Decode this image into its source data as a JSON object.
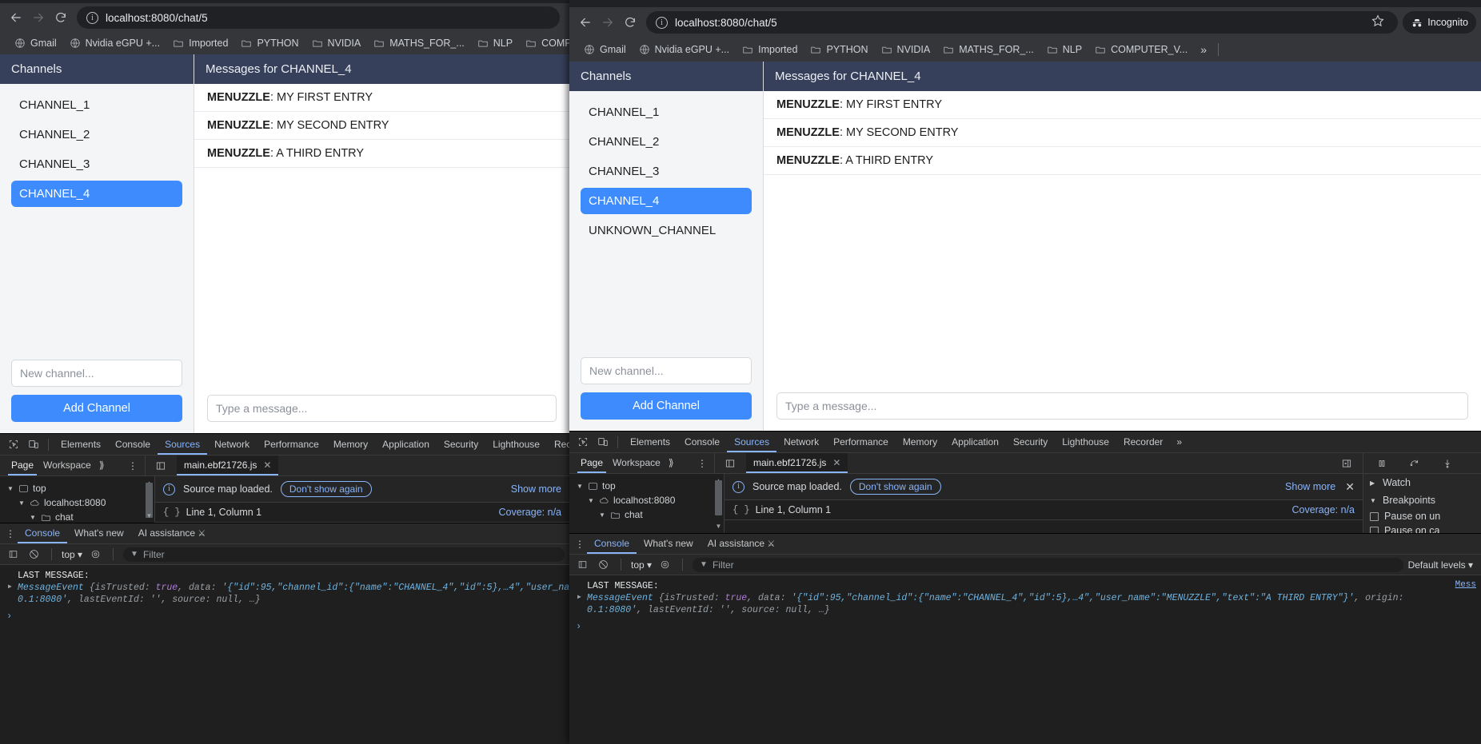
{
  "browser": {
    "url": "localhost:8080/chat/5",
    "nav": {
      "back": "back-arrow",
      "forward": "forward-arrow",
      "reload": "reload"
    },
    "bookmarks": [
      {
        "label": "Gmail",
        "icon": "globe"
      },
      {
        "label": "Nvidia eGPU +...",
        "icon": "globe"
      },
      {
        "label": "Imported",
        "icon": "folder"
      },
      {
        "label": "PYTHON",
        "icon": "folder"
      },
      {
        "label": "NVIDIA",
        "icon": "folder"
      },
      {
        "label": "MATHS_FOR_...",
        "icon": "folder"
      },
      {
        "label": "NLP",
        "icon": "folder"
      },
      {
        "label": "COMPUTER_V...",
        "icon": "folder"
      }
    ],
    "bookmarks_overflow": "»",
    "incognito_label": "Incognito"
  },
  "chat": {
    "sidebar_title": "Channels",
    "channels_left": [
      "CHANNEL_1",
      "CHANNEL_2",
      "CHANNEL_3",
      "CHANNEL_4"
    ],
    "channels_right": [
      "CHANNEL_1",
      "CHANNEL_2",
      "CHANNEL_3",
      "CHANNEL_4",
      "UNKNOWN_CHANNEL"
    ],
    "active_channel": "CHANNEL_4",
    "new_channel_placeholder": "New channel...",
    "add_channel_label": "Add Channel",
    "messages_title": "Messages for CHANNEL_4",
    "messages": [
      {
        "user": "MENUZZLE",
        "text": "MY FIRST ENTRY"
      },
      {
        "user": "MENUZZLE",
        "text": "MY SECOND ENTRY"
      },
      {
        "user": "MENUZZLE",
        "text": "A THIRD ENTRY"
      }
    ],
    "message_placeholder": "Type a message...",
    "accent": "#3d8bfd",
    "header_bg": "#36405a"
  },
  "devtools": {
    "tabs": [
      "Elements",
      "Console",
      "Sources",
      "Network",
      "Performance",
      "Memory",
      "Application",
      "Security",
      "Lighthouse",
      "Recorder"
    ],
    "selected_tab": "Sources",
    "more_tabs": "»",
    "nav_tabs": [
      "Page",
      "Workspace"
    ],
    "nav_selected": "Page",
    "nav_more": "⟫",
    "file_tab": "main.ebf21726.js",
    "file_tab_close": "✕",
    "tree": [
      {
        "label": "top",
        "depth": 0,
        "icon": "frame"
      },
      {
        "label": "localhost:8080",
        "depth": 1,
        "icon": "cloud"
      },
      {
        "label": "chat",
        "depth": 2,
        "icon": "folder"
      }
    ],
    "infobar_text": "Source map loaded.",
    "infobar_button": "Don't show again",
    "show_more": "Show more",
    "close": "✕",
    "status_position": "Line 1, Column 1",
    "coverage": "Coverage: n/a",
    "debugger": {
      "watch": "Watch",
      "breakpoints": "Breakpoints",
      "pause_uncaught": "Pause on un",
      "pause_caught": "Pause on ca"
    }
  },
  "console": {
    "tabs": [
      "Console",
      "What's new",
      "AI assistance"
    ],
    "selected_tab": "Console",
    "context": "top",
    "filter_placeholder": "Filter",
    "levels": "Default levels",
    "source_link": "Mess",
    "lines": {
      "lead": "LAST MESSAGE:",
      "event_type": "MessageEvent",
      "open_brace": "{",
      "is_trusted_key": "isTrusted:",
      "is_trusted_val": "true",
      "data_key": ", data:",
      "data_val_left": " '{\"id\":95,\"channel_id\":{\"name\":\"CHANNEL_4\",\"id\":5},…4\",\"user_name\":\"MENUZZLE\",\"text\":\"A THIRD ENTRY\"}'",
      "origin_key": ", origin:",
      "line2": "0.1:8080', lastEventId: '', source: null, …}",
      "line2_left": "0.1:8080'",
      "line2_rest": ", lastEventId: '', source: null, …}"
    },
    "prompt": "›"
  }
}
